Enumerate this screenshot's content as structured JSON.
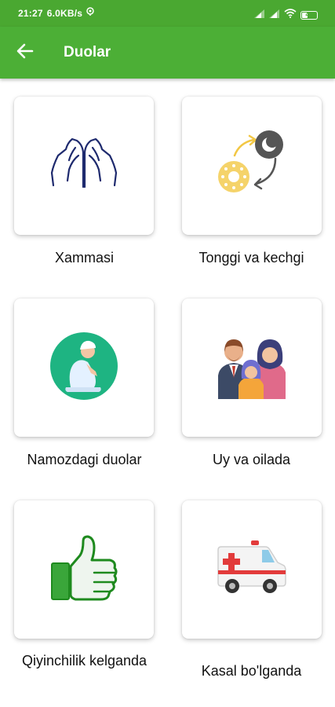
{
  "status_bar": {
    "time": "21:27",
    "speed": "6.0KB/s",
    "battery": "41",
    "battery_level_percent": 41
  },
  "app_bar": {
    "title": "Duolar",
    "back_icon": "arrow-left-icon"
  },
  "categories": [
    {
      "label": "Xammasi",
      "icon": "praying-hands-icon"
    },
    {
      "label": "Tonggi va kechgi",
      "icon": "day-night-cycle-icon"
    },
    {
      "label": "Namozdagi duolar",
      "icon": "praying-person-icon"
    },
    {
      "label": "Uy va oilada",
      "icon": "family-icon"
    },
    {
      "label": "Qiyinchilik kelganda",
      "icon": "thumbs-up-icon"
    },
    {
      "label": "Kasal bo'lganda",
      "icon": "ambulance-icon"
    }
  ],
  "colors": {
    "primary": "#4caf36",
    "status_bar": "#4aa831"
  }
}
